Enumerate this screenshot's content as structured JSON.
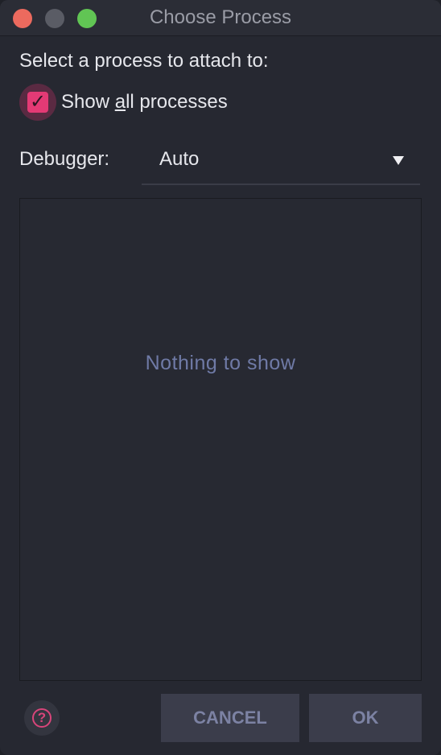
{
  "window": {
    "title": "Choose Process"
  },
  "dialog": {
    "prompt": "Select a process to attach to:",
    "show_all": {
      "label_prefix": "Show ",
      "label_mnemonic": "a",
      "label_suffix": "ll processes",
      "checked": true,
      "check_glyph": "✓"
    },
    "debugger": {
      "label": "Debugger:",
      "value": "Auto"
    },
    "process_list": {
      "empty_text": "Nothing to show"
    },
    "help": {
      "glyph": "?",
      "icon": "help-icon"
    },
    "buttons": {
      "cancel": "CANCEL",
      "ok": "OK"
    }
  },
  "colors": {
    "accent": "#e33a75",
    "close": "#ec6a5e",
    "minimize": "#5a5c65",
    "maximize": "#61c554",
    "empty_text": "#6f7aa6"
  }
}
